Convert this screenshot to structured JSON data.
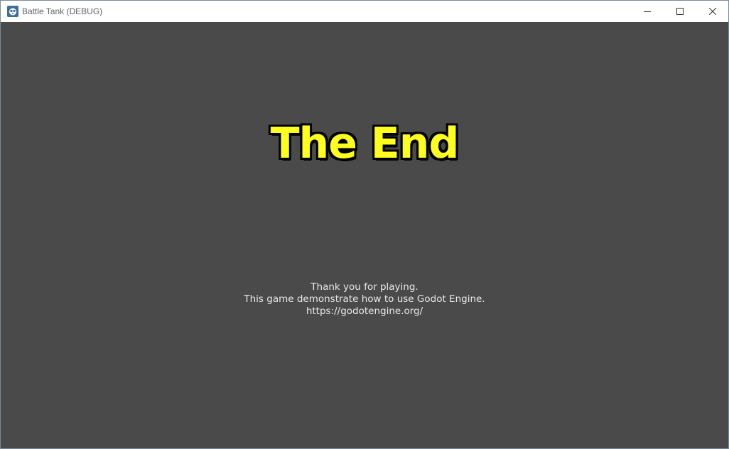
{
  "window": {
    "title": "Battle Tank (DEBUG)",
    "app_icon": "godot-icon",
    "controls": {
      "minimize": "minimize-icon",
      "maximize": "maximize-icon",
      "close": "close-icon"
    }
  },
  "game": {
    "heading": "The End",
    "credits": [
      "Thank you for playing.",
      "This game demonstrate how to use Godot Engine.",
      "https://godotengine.org/"
    ],
    "colors": {
      "background": "#4a4a4a",
      "heading_fill": "#ffff1e",
      "heading_outline": "#000000",
      "credits_text": "#e8e8e8"
    }
  }
}
